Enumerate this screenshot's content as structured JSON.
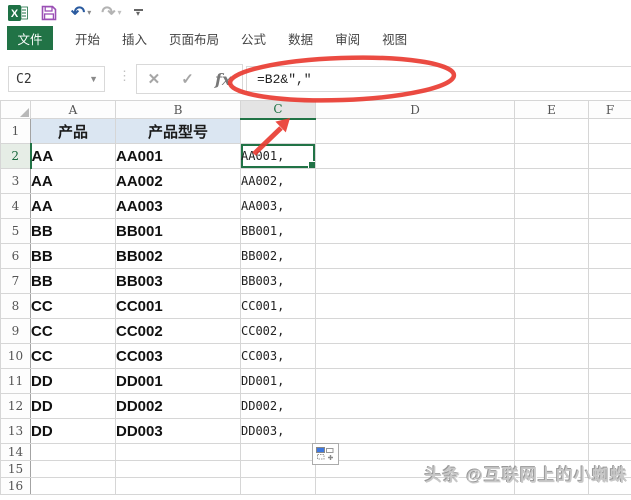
{
  "title_bar": {
    "icons": [
      "excel-logo",
      "save",
      "undo",
      "redo",
      "customize-quick-access-toolbar"
    ]
  },
  "ribbon": {
    "file_tab": "文件",
    "tabs": [
      "开始",
      "插入",
      "页面布局",
      "公式",
      "数据",
      "审阅",
      "视图"
    ]
  },
  "formula_bar": {
    "name_box": "C2",
    "cancel_icon": "✕",
    "enter_icon": "✓",
    "fx_label": "fx",
    "formula": "=B2&″,″"
  },
  "grid": {
    "column_headers": [
      "A",
      "B",
      "C",
      "D",
      "E",
      "F"
    ],
    "selected_column": "C",
    "selected_cell": "C2",
    "selected_row": 2,
    "header_row": {
      "row": 1,
      "a": "产品",
      "b": "产品型号"
    },
    "rows": [
      {
        "row": 2,
        "a": "AA",
        "b": "AA001",
        "c": "AA001,"
      },
      {
        "row": 3,
        "a": "AA",
        "b": "AA002",
        "c": "AA002,"
      },
      {
        "row": 4,
        "a": "AA",
        "b": "AA003",
        "c": "AA003,"
      },
      {
        "row": 5,
        "a": "BB",
        "b": "BB001",
        "c": "BB001,"
      },
      {
        "row": 6,
        "a": "BB",
        "b": "BB002",
        "c": "BB002,"
      },
      {
        "row": 7,
        "a": "BB",
        "b": "BB003",
        "c": "BB003,"
      },
      {
        "row": 8,
        "a": "CC",
        "b": "CC001",
        "c": "CC001,"
      },
      {
        "row": 9,
        "a": "CC",
        "b": "CC002",
        "c": "CC002,"
      },
      {
        "row": 10,
        "a": "CC",
        "b": "CC003",
        "c": "CC003,"
      },
      {
        "row": 11,
        "a": "DD",
        "b": "DD001",
        "c": "DD001,"
      },
      {
        "row": 12,
        "a": "DD",
        "b": "DD002",
        "c": "DD002,"
      },
      {
        "row": 13,
        "a": "DD",
        "b": "DD003",
        "c": "DD003,"
      },
      {
        "row": 14,
        "small": true
      },
      {
        "row": 15,
        "small": true
      },
      {
        "row": 16,
        "small": true
      }
    ]
  },
  "annotations": {
    "ellipse": "formula-circled",
    "arrow": "arrow-from-C2-to-formula"
  },
  "watermark": "头条 @互联网上的小蜘蛛",
  "colors": {
    "excel_green": "#217346",
    "header_fill": "#dbe6f2",
    "annotation_red": "#e93c32",
    "autofill_blue": "#3e78e0"
  }
}
